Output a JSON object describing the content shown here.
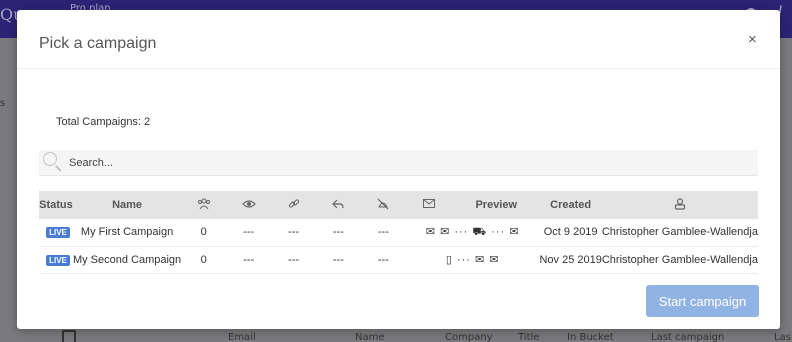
{
  "background": {
    "logo": "Qu",
    "plan": "Pro plan",
    "side_letter": "s",
    "user_initial": "I",
    "columns": [
      "Email",
      "Name",
      "Company",
      "Title",
      "In Bucket",
      "Last campaign",
      "Las"
    ]
  },
  "modal": {
    "title": "Pick a campaign",
    "close": "×",
    "total_label": "Total Campaigns: 2",
    "search_placeholder": "Search...",
    "start_button": "Start campaign"
  },
  "table": {
    "headers": {
      "status": "Status",
      "name": "Name",
      "preview": "Preview",
      "created": "Created"
    },
    "header_icons": [
      "people-icon",
      "eye-icon",
      "link-icon",
      "reply-icon",
      "unsubscribe-icon",
      "envelope-icon",
      "owner-icon"
    ],
    "rows": [
      {
        "status": "LIVE",
        "name": "My First Campaign",
        "sent": "0",
        "opened": "---",
        "clicked": "---",
        "replied": "---",
        "unsubscribed": "---",
        "preview": "✉ ✉ ··· ⛟ ··· ✉",
        "created": "Oct 9 2019",
        "owner": "Christopher Gamblee-Wallendja"
      },
      {
        "status": "LIVE",
        "name": "My Second Campaign",
        "sent": "0",
        "opened": "---",
        "clicked": "---",
        "replied": "---",
        "unsubscribed": "---",
        "preview": "▯ ··· ✉ ✉",
        "created": "Nov 25 2019",
        "owner": "Christopher Gamblee-Wallendja"
      }
    ]
  },
  "colors": {
    "header_bg": "#2b2475",
    "badge": "#4a7dd2",
    "button": "#91b3e3"
  }
}
